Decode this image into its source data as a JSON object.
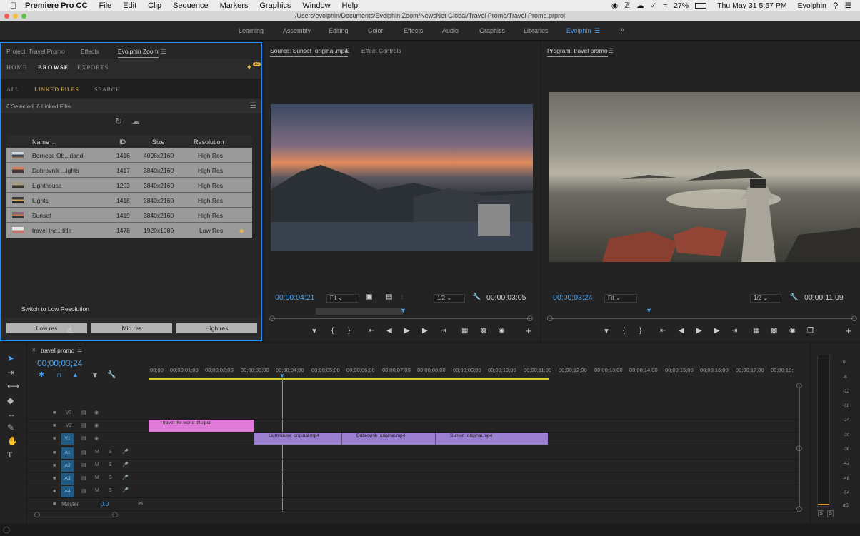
{
  "menubar": {
    "app": "Premiere Pro CC",
    "items": [
      "File",
      "Edit",
      "Clip",
      "Sequence",
      "Markers",
      "Graphics",
      "Window",
      "Help"
    ],
    "battery": "27%",
    "datetime": "Thu May 31  5:57 PM",
    "user": "Evolphin"
  },
  "window_title": "/Users/evolphin/Documents/Evolphin Zoom/NewsNet Global/Travel Promo/Travel Promo.prproj",
  "workspaces": {
    "items": [
      "Learning",
      "Assembly",
      "Editing",
      "Color",
      "Effects",
      "Audio",
      "Graphics",
      "Libraries",
      "Evolphin"
    ],
    "active": "Evolphin",
    "more": "»"
  },
  "project_panel": {
    "tabs": [
      "Project: Travel Promo",
      "Effects",
      "Evolphin Zoom"
    ],
    "active_tab": "Evolphin Zoom",
    "nav": [
      "HOME",
      "BROWSE",
      "EXPORTS"
    ],
    "active_nav": "BROWSE",
    "notification_count": "10",
    "subnav": [
      "ALL",
      "LINKED FILES",
      "SEARCH"
    ],
    "active_subnav": "LINKED FILES",
    "selection_status": "6 Selected, 6 Linked Files",
    "table": {
      "columns": [
        "Name",
        "ID",
        "Size",
        "Resolution"
      ],
      "rows": [
        {
          "name": "Bernese Ob...rland",
          "id": "1416",
          "size": "4096x2160",
          "res": "High Res"
        },
        {
          "name": "Dubrovnik ...ights",
          "id": "1417",
          "size": "3840x2160",
          "res": "High Res"
        },
        {
          "name": "Lighthouse",
          "id": "1293",
          "size": "3840x2160",
          "res": "High Res"
        },
        {
          "name": "Lights",
          "id": "1418",
          "size": "3840x2160",
          "res": "High Res"
        },
        {
          "name": "Sunset",
          "id": "1419",
          "size": "3840x2160",
          "res": "High Res"
        },
        {
          "name": "travel the...title",
          "id": "1478",
          "size": "1920x1080",
          "res": "Low Res"
        }
      ]
    },
    "switch_label": "Switch to Low Resolution",
    "buttons": [
      "Low res",
      "Mid res",
      "High res"
    ]
  },
  "source_monitor": {
    "tabs": [
      "Source: Sunset_original.mp4",
      "Effect Controls"
    ],
    "timecode": "00:00:04:21",
    "fit": "Fit",
    "quality": "1/2",
    "duration": "00:00:03:05"
  },
  "program_monitor": {
    "tab": "Program: travel promo",
    "timecode": "00;00;03;24",
    "fit": "Fit",
    "quality": "1/2",
    "duration": "00;00;11;09"
  },
  "timeline": {
    "tab": "travel promo",
    "timecode": "00;00;03;24",
    "ruler": [
      ";00;00",
      "00;00;01;00",
      "00;00;02;00",
      "00;00;03;00",
      "00;00;04;00",
      "00;00;05;00",
      "00;00;06;00",
      "00;00;07;00",
      "00;00;08;00",
      "00;00;09;00",
      "00;00;10;00",
      "00;00;11;00",
      "00;00;12;00",
      "00;00;13;00",
      "00;00;14;00",
      "00;00;15;00",
      "00;00;16;00",
      "00;00;17;00",
      "00;00;18;"
    ],
    "video_tracks": [
      "V3",
      "V2",
      "V1"
    ],
    "audio_tracks": [
      "A1",
      "A2",
      "A3",
      "A4"
    ],
    "master_label": "Master",
    "master_value": "0.0",
    "clips": {
      "graphic": "travel the world title.psd",
      "v1": [
        "Lighthouse_original.mp4",
        "Dubrovnik_original.mp4",
        "Sunset_original.mp4"
      ]
    }
  },
  "meter": {
    "scale": [
      "0",
      "-6",
      "-12",
      "-18",
      "-24",
      "-30",
      "-36",
      "-42",
      "-48",
      "-54",
      "dB"
    ],
    "solo": [
      "S",
      "S"
    ]
  }
}
